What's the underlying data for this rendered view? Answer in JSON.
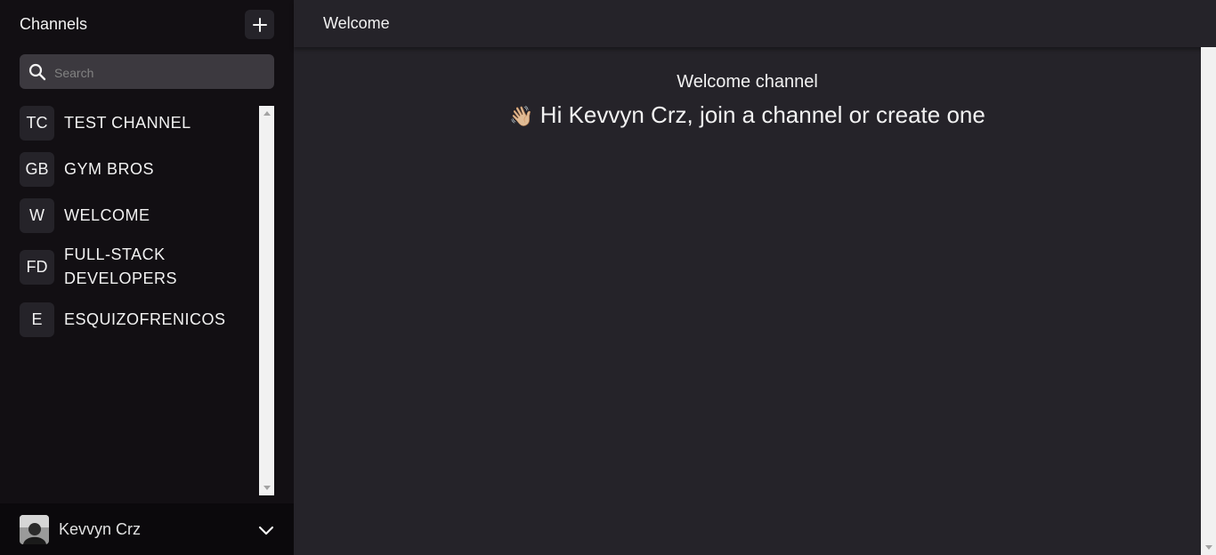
{
  "sidebar": {
    "title": "Channels",
    "add_icon": "plus-icon",
    "search": {
      "placeholder": "Search",
      "icon": "search-icon"
    },
    "channels": [
      {
        "initials": "TC",
        "name": "TEST CHANNEL"
      },
      {
        "initials": "GB",
        "name": "GYM BROS"
      },
      {
        "initials": "W",
        "name": "WELCOME"
      },
      {
        "initials": "FD",
        "name": "FULL-STACK DEVELOPERS"
      },
      {
        "initials": "E",
        "name": "ESQUIZOFRENICOS"
      }
    ]
  },
  "user": {
    "name": "Kevvyn Crz",
    "menu_icon": "chevron-down-icon"
  },
  "header": {
    "title": "Welcome"
  },
  "main": {
    "channel_title": "Welcome channel",
    "wave_emoji": "👋🏼",
    "greeting": "Hi Kevvyn Crz, join a channel or create one"
  },
  "colors": {
    "sidebar_bg": "#120f13",
    "main_bg": "#252329",
    "search_bg": "#3c393f",
    "user_bar_bg": "#0b090c",
    "text": "#f2f2f2"
  }
}
